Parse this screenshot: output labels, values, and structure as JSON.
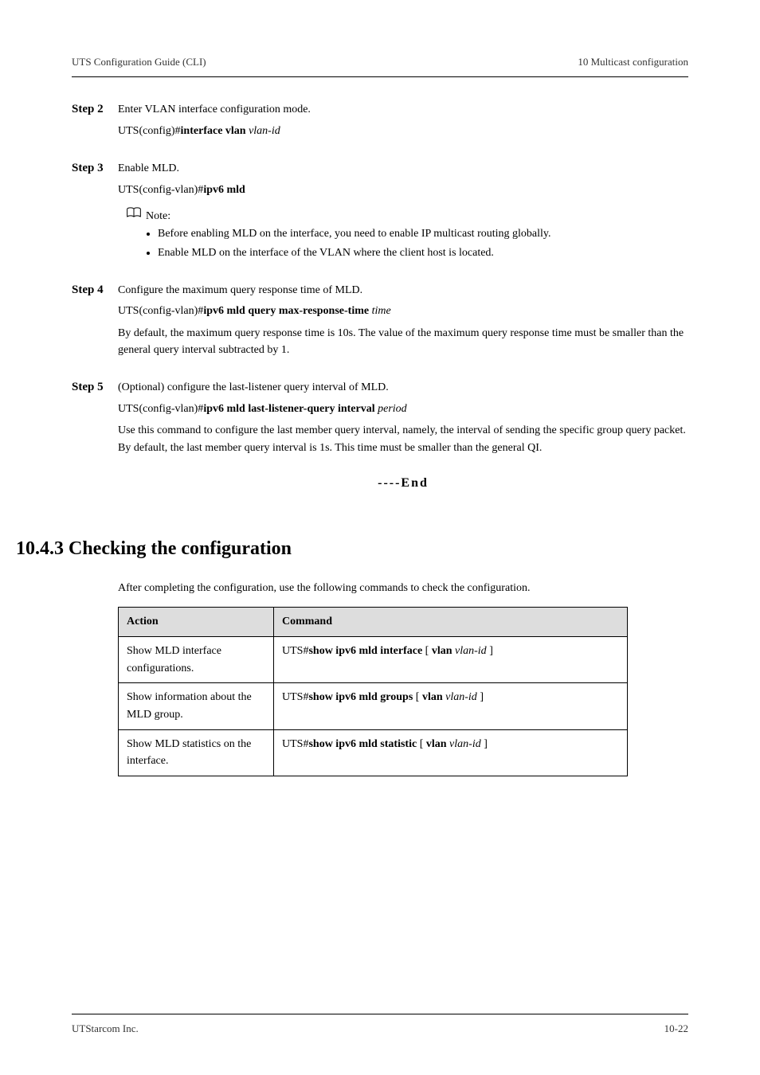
{
  "header": {
    "left": "UTS Configuration Guide (CLI)",
    "right": "10 Multicast configuration"
  },
  "steps": [
    {
      "label": "Step 2",
      "text": "Enter VLAN interface configuration mode.",
      "cmd_prefix": "UTS(config)#",
      "cmd_bold": "interface vlan",
      "cmd_italic": " vlan-id",
      "desc": ""
    },
    {
      "label": "Step 3",
      "text": "Enable MLD.",
      "cmd_prefix": "UTS(config-vlan)#",
      "cmd_bold": "ipv6 mld",
      "cmd_italic": "",
      "desc": ""
    },
    {
      "label": "Step 4",
      "text": "Configure the maximum query response time of MLD.",
      "cmd_prefix": "UTS(config-vlan)#",
      "cmd_bold": "ipv6 mld query max-response-time",
      "cmd_italic": " time",
      "desc": "By default, the maximum query response time is 10s. The value of the maximum query response time must be smaller than the general query interval subtracted by 1."
    },
    {
      "label": "Step 5",
      "text": "(Optional) configure the last-listener query interval of MLD.",
      "cmd_prefix": "UTS(config-vlan)#",
      "cmd_bold": "ipv6 mld last-listener-query interval",
      "cmd_italic": " period",
      "desc": "Use this command to configure the last member query interval, namely, the interval of sending the specific group query packet. By default, the last member query interval is 1s. This time must be smaller than the general QI."
    }
  ],
  "note": {
    "label": "Note:",
    "items": [
      "Before enabling MLD on the interface, you need to enable IP multicast routing globally.",
      "Enable MLD on the interface of the VLAN where the client host is located."
    ]
  },
  "end_divider": "----End",
  "section_heading": "10.4.3 Checking the configuration",
  "table_intro": "After completing the configuration, use the following commands to check the configuration.",
  "table": {
    "headers": {
      "action": "Action",
      "command": "Command"
    },
    "rows": [
      {
        "action": "Show MLD interface configurations.",
        "cmd_prefix": "UTS#",
        "cmd_bold": "show ipv6 mld interface",
        "cmd_suffix_plain": " [",
        "cmd_suffix_bold": " vlan",
        "cmd_suffix_italic": " vlan-id",
        "cmd_suffix_end": " ]"
      },
      {
        "action": "Show information about the MLD group.",
        "cmd_prefix": "UTS#",
        "cmd_bold": "show ipv6 mld groups",
        "cmd_suffix_plain": " [",
        "cmd_suffix_bold": " vlan",
        "cmd_suffix_italic": " vlan-id",
        "cmd_suffix_end": " ]"
      },
      {
        "action": "Show MLD statistics on the interface.",
        "cmd_prefix": "UTS#",
        "cmd_bold": "show ipv6 mld statistic",
        "cmd_suffix_plain": " [",
        "cmd_suffix_bold": " vlan",
        "cmd_suffix_italic": " vlan-id",
        "cmd_suffix_end": " ]"
      }
    ]
  },
  "footer": {
    "left": "UTStarcom Inc.",
    "right": "10-22"
  }
}
